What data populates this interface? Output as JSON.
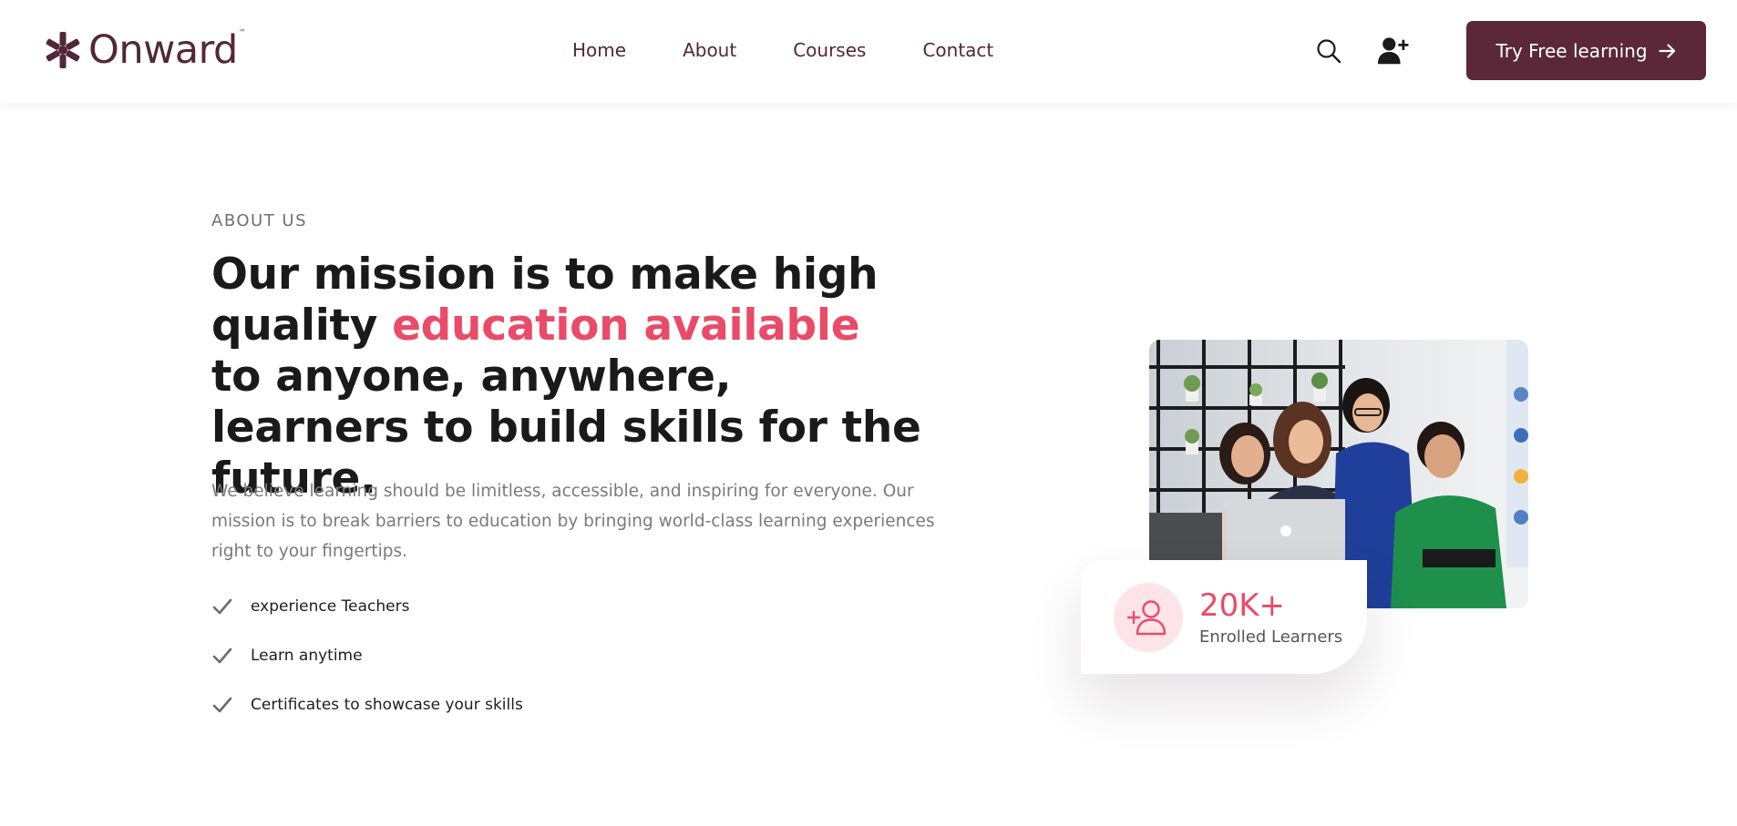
{
  "header": {
    "logo_text": "Onward",
    "logo_tm": "™",
    "nav": [
      {
        "label": "Home"
      },
      {
        "label": "About"
      },
      {
        "label": "Courses"
      },
      {
        "label": "Contact"
      }
    ],
    "cta_label": "Try Free learning",
    "icons": [
      "search-icon",
      "add-user-icon",
      "arrow-right-icon"
    ]
  },
  "about": {
    "eyebrow": "ABOUT US",
    "headline_part1": "Our mission is to make high quality ",
    "headline_accent": "education available",
    "headline_part2": " to anyone, anywhere, learners to build skills for the future.",
    "body": "We believe learning should be limitless, accessible, and inspiring for everyone. Our mission is to break barriers to education by bringing world-class learning experiences right to your fingertips.",
    "features": [
      {
        "label": "experience Teachers"
      },
      {
        "label": "Learn anytime"
      },
      {
        "label": "Certificates to showcase your skills"
      }
    ]
  },
  "stats": {
    "value": "20K+",
    "label": "Enrolled Learners"
  },
  "colors": {
    "brand": "#522838",
    "cta_bg": "#5a2838",
    "accent": "#e94b68",
    "accent_soft": "#fde4e8",
    "muted_text": "#7a7a7a"
  }
}
